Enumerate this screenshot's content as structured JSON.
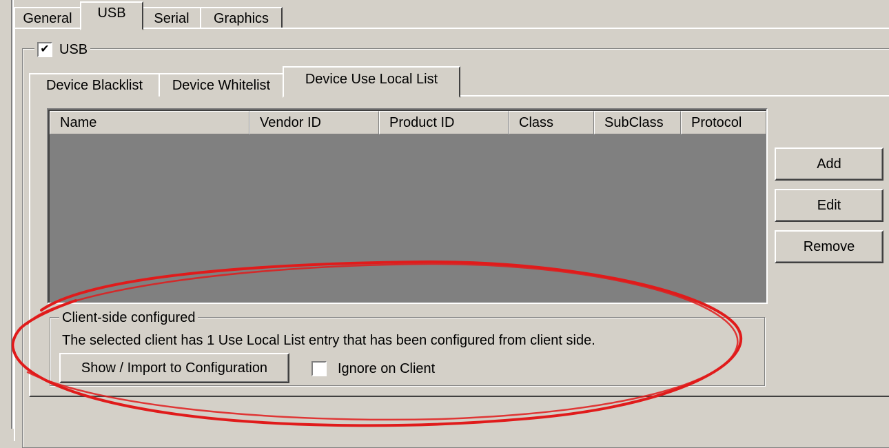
{
  "colors": {
    "window_bg": "#d4d0c8",
    "list_bg": "#808080",
    "annotation": "#e01b1b"
  },
  "main_tabs": [
    {
      "label": "General",
      "active": false
    },
    {
      "label": "USB",
      "active": true
    },
    {
      "label": "Serial",
      "active": false
    },
    {
      "label": "Graphics",
      "active": false
    }
  ],
  "usb_group": {
    "checkbox_label": "USB",
    "checked": true,
    "check_glyph": "✔"
  },
  "device_tabs": [
    {
      "label": "Device Blacklist",
      "active": false
    },
    {
      "label": "Device Whitelist",
      "active": false
    },
    {
      "label": "Device Use Local List",
      "active": true
    }
  ],
  "device_list": {
    "columns": [
      "Name",
      "Vendor ID",
      "Product ID",
      "Class",
      "SubClass",
      "Protocol"
    ],
    "rows": []
  },
  "side_buttons": {
    "add": "Add",
    "edit": "Edit",
    "remove": "Remove"
  },
  "client_side": {
    "legend": "Client-side configured",
    "message": "The selected client has 1 Use Local List entry that has been configured from client side.",
    "import_button": "Show / Import to Configuration",
    "ignore_label": "Ignore on Client",
    "ignore_checked": false
  },
  "annotation": {
    "shape": "ellipse",
    "icon": "red-ellipse-highlight"
  }
}
